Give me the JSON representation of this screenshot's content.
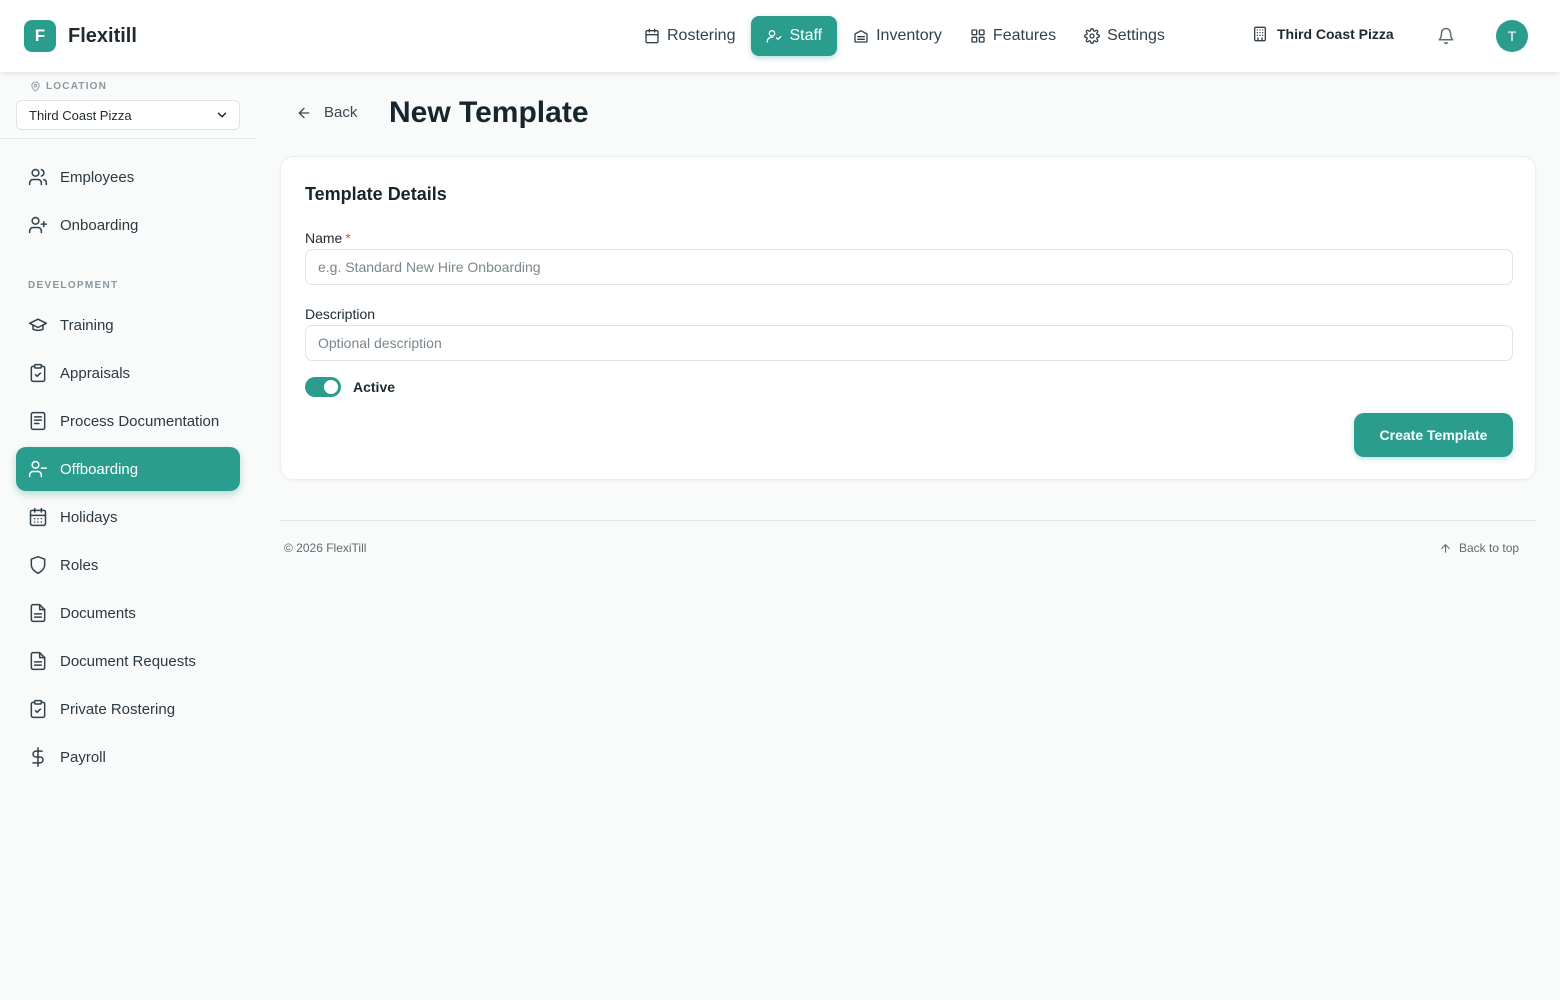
{
  "app": {
    "logo_letter": "F",
    "name": "Flexitill"
  },
  "topnav": {
    "items": [
      {
        "label": "Rostering",
        "icon": "calendar-icon"
      },
      {
        "label": "Staff",
        "icon": "users-icon",
        "active": true
      },
      {
        "label": "Inventory",
        "icon": "package-icon"
      },
      {
        "label": "Features",
        "icon": "grid-icon"
      },
      {
        "label": "Settings",
        "icon": "gear-icon"
      }
    ],
    "location": "Third Coast Pizza",
    "avatar_initial": "T"
  },
  "sidebar": {
    "location_label": "LOCATION",
    "location_value": "Third Coast Pizza",
    "items": [
      {
        "label": "Employees",
        "icon": "users-icon"
      },
      {
        "label": "Onboarding",
        "icon": "user-plus-icon"
      }
    ],
    "section_development": "DEVELOPMENT",
    "dev_items": [
      {
        "label": "Training",
        "icon": "graduation-cap-icon"
      },
      {
        "label": "Appraisals",
        "icon": "clipboard-check-icon"
      },
      {
        "label": "Process Documentation",
        "icon": "notebook-icon"
      },
      {
        "label": "Offboarding",
        "icon": "user-minus-icon",
        "active": true
      },
      {
        "label": "Holidays",
        "icon": "calendar-days-icon"
      },
      {
        "label": "Roles",
        "icon": "shield-icon"
      },
      {
        "label": "Documents",
        "icon": "file-text-icon"
      },
      {
        "label": "Document Requests",
        "icon": "file-text-icon"
      },
      {
        "label": "Private Rostering",
        "icon": "clipboard-check-icon"
      },
      {
        "label": "Payroll",
        "icon": "dollar-icon"
      }
    ]
  },
  "page": {
    "back_label": "Back",
    "title": "New Template"
  },
  "form": {
    "card_title": "Template Details",
    "name_label": "Name",
    "name_required_mark": "*",
    "name_value": "",
    "name_placeholder": "e.g. Standard New Hire Onboarding",
    "description_label": "Description",
    "description_value": "",
    "description_placeholder": "Optional description",
    "active_label": "Active",
    "active_on": true,
    "submit_label": "Create Template"
  },
  "footer": {
    "copyright": "© 2026 FlexiTill",
    "back_to_top": "Back to top"
  },
  "colors": {
    "accent": "#2a9d8f",
    "page_bg": "#f9fafa",
    "text": "#1f2a30",
    "required": "#d9534f"
  }
}
